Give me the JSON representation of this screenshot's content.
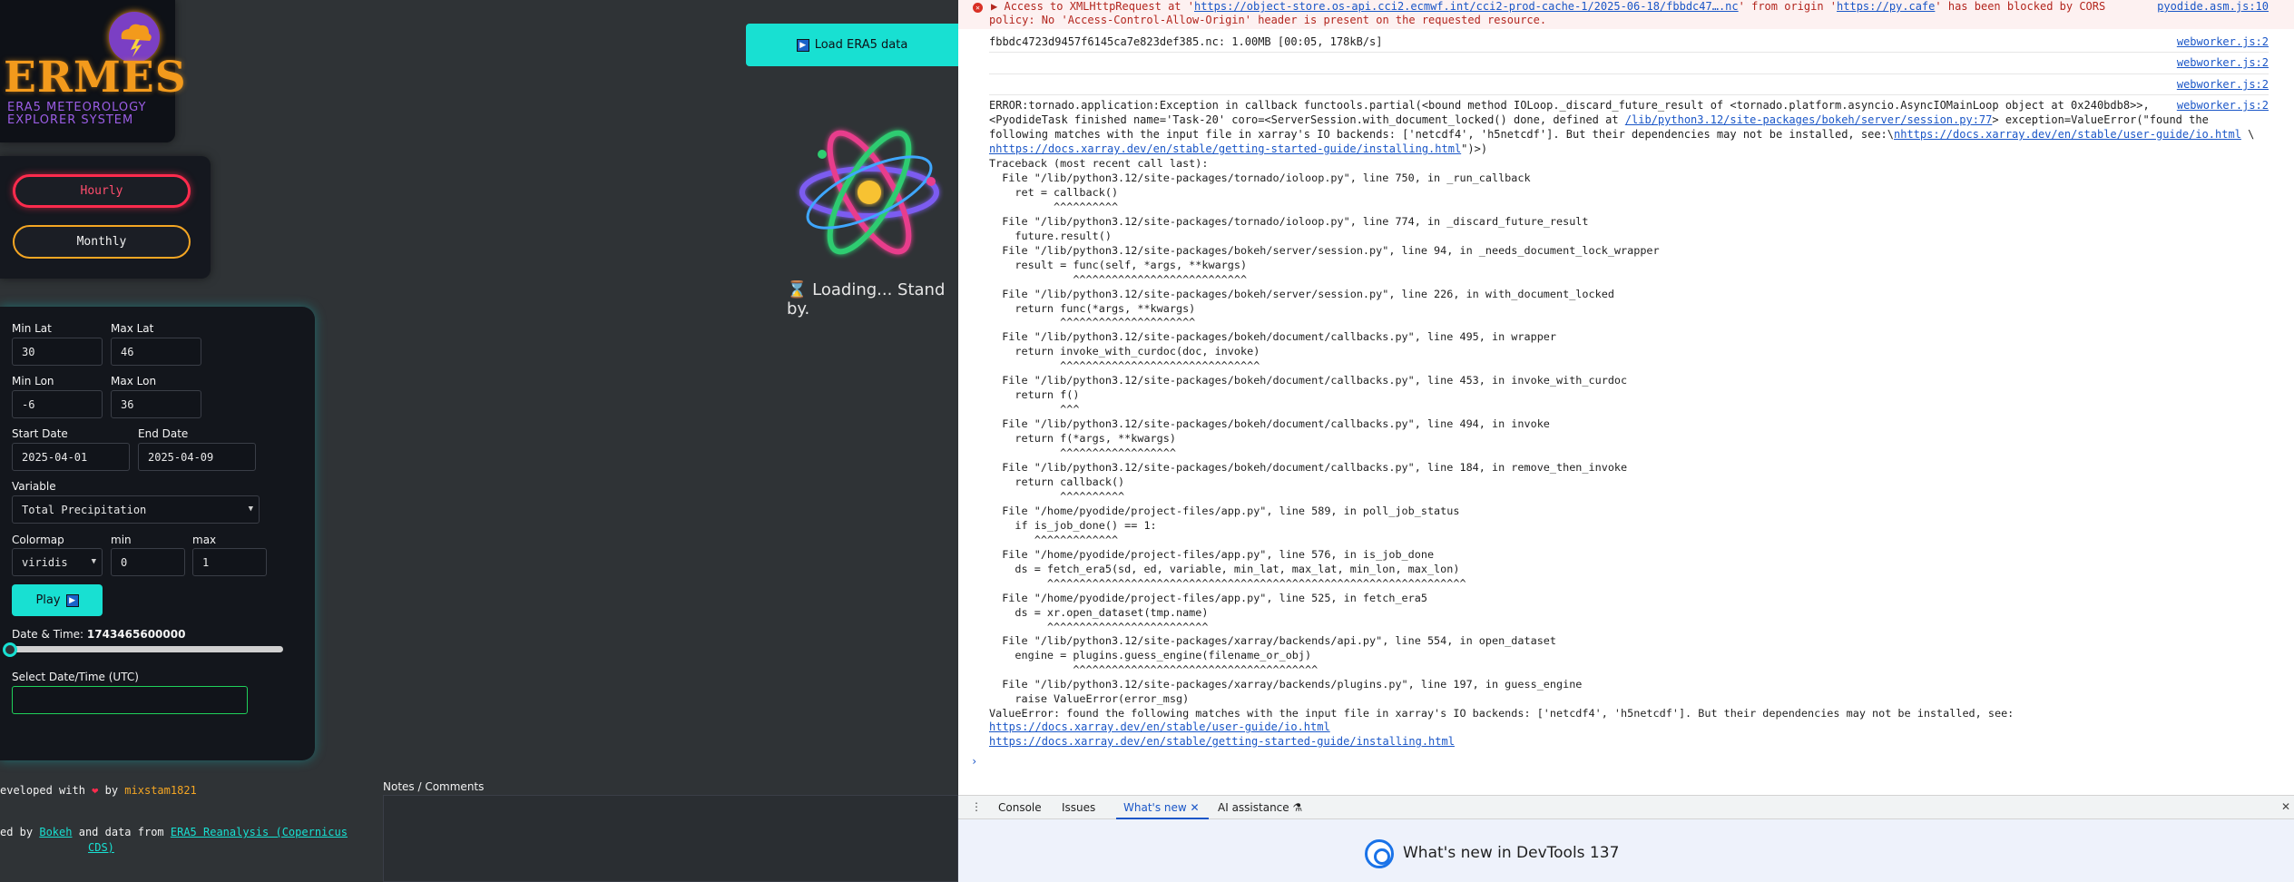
{
  "app": {
    "logo": {
      "title": "ERMES",
      "subtitle_line1": "ERA5 METEOROLOGY",
      "subtitle_line2": "EXPLORER SYSTEM"
    },
    "frequency": {
      "hourly_label": "Hourly",
      "monthly_label": "Monthly"
    },
    "controls": {
      "min_lat_label": "Min Lat",
      "min_lat_value": "30",
      "max_lat_label": "Max Lat",
      "max_lat_value": "46",
      "min_lon_label": "Min Lon",
      "min_lon_value": "-6",
      "max_lon_label": "Max Lon",
      "max_lon_value": "36",
      "start_date_label": "Start Date",
      "start_date_value": "2025-04-01",
      "end_date_label": "End Date",
      "end_date_value": "2025-04-09",
      "variable_label": "Variable",
      "variable_value": "Total Precipitation",
      "colormap_label": "Colormap",
      "colormap_value": "viridis",
      "min_label": "min",
      "min_value": "0",
      "max_label": "max",
      "max_value": "1",
      "play_label": "Play",
      "datetime_label": "Date & Time:",
      "datetime_value": "1743465600000",
      "select_datetime_label": "Select Date/Time (UTC)",
      "slider_level": 0
    },
    "load_button_label": "Load ERA5 data",
    "loading_text": "⌛ Loading... Stand by.",
    "credits": {
      "developed_prefix": "eveloped with",
      "developed_by": "by",
      "username": "mixstam1821",
      "powered_prefix": "ed by",
      "bokeh_link": "Bokeh",
      "data_from": "and data from",
      "era5_link_line1": "ERA5 Reanalysis (Copernicus",
      "era5_link_line2": "CDS)"
    },
    "notes_label": "Notes / Comments",
    "colors": {
      "accent": "#18e0d2",
      "hourly": "#ff2b4d",
      "monthly": "#f5a623",
      "logo": "#f39a1c",
      "purple": "#9b5de5"
    }
  },
  "devtools": {
    "cors_error": {
      "line1_prefix": "Access to XMLHttpRequest at '",
      "line1_url": "https://object-store.os-api.cci2.ecmwf.int/cci2-prod-cache-1/2025-06-18/fbbdc47….nc",
      "line1_mid": "' from origin '",
      "line1_origin": "https://py.cafe",
      "line1_suffix": "' has been blocked by CORS",
      "line2": "policy: No 'Access-Control-Allow-Origin' header is present on the requested resource.",
      "source": "pyodide.asm.js:10"
    },
    "progress_line": "fbbdc4723d9457f6145ca7e823def385.nc: 1.00MB [00:05, 178kB/s]",
    "source_webworker": "webworker.js:2",
    "error_line1": "ERROR:tornado.application:Exception in callback functools.partial(<bound method IOLoop._discard_future_result of <tornado.platform.asyncio.AsyncIOMainLoop object at 0x240bdb8>>,",
    "error_line2_prefix": "<PyodideTask finished name='Task-20' coro=<ServerSession.with_document_locked() done, defined at ",
    "error_line2_link": "/lib/python3.12/site-packages/bokeh/server/session.py:77",
    "error_line2_suffix": "> exception=ValueError(\"found the",
    "error_line3_prefix": "following matches with the input file in xarray's IO backends: ['netcdf4', 'h5netcdf']. But their dependencies may not be installed, see:\\",
    "error_line3_link": "nhttps://docs.xarray.dev/en/stable/user-guide/io.html",
    "error_line3_suffix": " \\",
    "error_line4_link": "nhttps://docs.xarray.dev/en/stable/getting-started-guide/installing.html",
    "error_line4_suffix": "\")>)",
    "traceback": "Traceback (most recent call last):\n  File \"/lib/python3.12/site-packages/tornado/ioloop.py\", line 750, in _run_callback\n    ret = callback()\n          ^^^^^^^^^^\n  File \"/lib/python3.12/site-packages/tornado/ioloop.py\", line 774, in _discard_future_result\n    future.result()\n  File \"/lib/python3.12/site-packages/bokeh/server/session.py\", line 94, in _needs_document_lock_wrapper\n    result = func(self, *args, **kwargs)\n             ^^^^^^^^^^^^^^^^^^^^^^^^^^^\n  File \"/lib/python3.12/site-packages/bokeh/server/session.py\", line 226, in with_document_locked\n    return func(*args, **kwargs)\n           ^^^^^^^^^^^^^^^^^^^^^\n  File \"/lib/python3.12/site-packages/bokeh/document/callbacks.py\", line 495, in wrapper\n    return invoke_with_curdoc(doc, invoke)\n           ^^^^^^^^^^^^^^^^^^^^^^^^^^^^^^^\n  File \"/lib/python3.12/site-packages/bokeh/document/callbacks.py\", line 453, in invoke_with_curdoc\n    return f()\n           ^^^\n  File \"/lib/python3.12/site-packages/bokeh/document/callbacks.py\", line 494, in invoke\n    return f(*args, **kwargs)\n           ^^^^^^^^^^^^^^^^^^\n  File \"/lib/python3.12/site-packages/bokeh/document/callbacks.py\", line 184, in remove_then_invoke\n    return callback()\n           ^^^^^^^^^^\n  File \"/home/pyodide/project-files/app.py\", line 589, in poll_job_status\n    if is_job_done() == 1:\n       ^^^^^^^^^^^^^\n  File \"/home/pyodide/project-files/app.py\", line 576, in is_job_done\n    ds = fetch_era5(sd, ed, variable, min_lat, max_lat, min_lon, max_lon)\n         ^^^^^^^^^^^^^^^^^^^^^^^^^^^^^^^^^^^^^^^^^^^^^^^^^^^^^^^^^^^^^^^^^\n  File \"/home/pyodide/project-files/app.py\", line 525, in fetch_era5\n    ds = xr.open_dataset(tmp.name)\n         ^^^^^^^^^^^^^^^^^^^^^^^^^\n  File \"/lib/python3.12/site-packages/xarray/backends/api.py\", line 554, in open_dataset\n    engine = plugins.guess_engine(filename_or_obj)\n             ^^^^^^^^^^^^^^^^^^^^^^^^^^^^^^^^^^^^^^\n  File \"/lib/python3.12/site-packages/xarray/backends/plugins.py\", line 197, in guess_engine\n    raise ValueError(error_msg)\nValueError: found the following matches with the input file in xarray's IO backends: ['netcdf4', 'h5netcdf']. But their dependencies may not be installed, see:",
    "final_link1": "https://docs.xarray.dev/en/stable/user-guide/io.html",
    "final_link2": "https://docs.xarray.dev/en/stable/getting-started-guide/installing.html",
    "prompt": "›",
    "tabs": {
      "console": "Console",
      "issues": "Issues",
      "whats_new": "What's new",
      "ai": "AI assistance"
    },
    "whats_new_banner": "What's new in DevTools 137"
  }
}
